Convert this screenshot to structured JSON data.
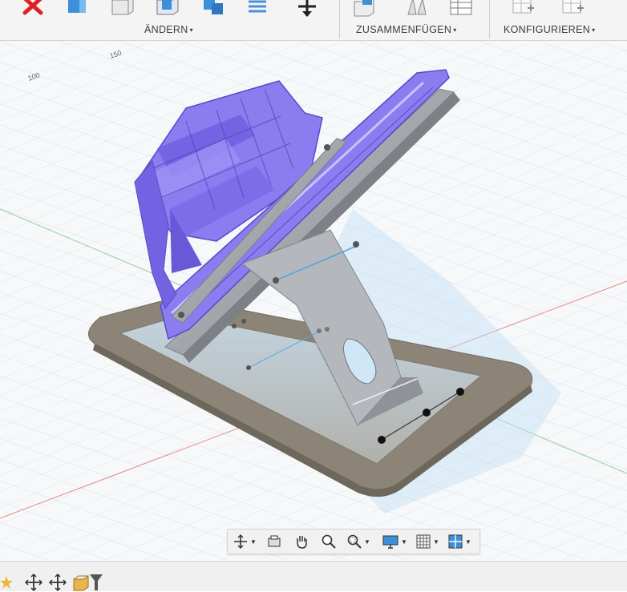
{
  "toolbar": {
    "groups": [
      {
        "label": "ÄNDERN",
        "caret": "▾"
      },
      {
        "label": "ZUSAMMENFÜGEN",
        "caret": "▾"
      },
      {
        "label": "KONFIGURIEREN",
        "caret": "▾"
      }
    ],
    "icons": [
      "close-red-x-icon",
      "press-pull-icon",
      "fillet-box-icon",
      "shell-box-icon",
      "combine-blocks-icon",
      "replace-face-icon",
      "move-arrows-icon",
      "new-component-icon",
      "joint-icon",
      "table-icon",
      "config-table-icon",
      "config-rule-icon"
    ]
  },
  "viewport": {
    "ruler_labels": [
      "150",
      "100"
    ],
    "colors": {
      "body": "#8b7cf0",
      "body_dark": "#5b48c9",
      "metal": "#9a9ea3",
      "grid": "#dcdfe3",
      "red_axis": "#e35a5a",
      "green_axis": "#5fc070"
    }
  },
  "nav_bar": {
    "items": [
      "orbit-icon",
      "look-at-icon",
      "pan-hand-icon",
      "zoom-icon",
      "zoom-window-icon",
      "display-settings-icon",
      "grid-settings-icon",
      "viewports-icon"
    ]
  },
  "bottom_bar": {
    "icons": [
      "star-marker-icon",
      "move-icon",
      "move-icon",
      "box-icon",
      "funnel-icon"
    ]
  }
}
